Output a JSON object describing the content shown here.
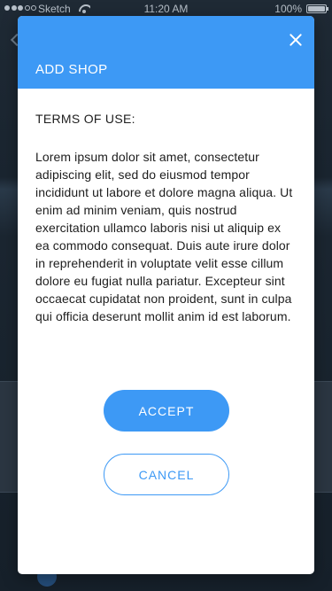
{
  "status_bar": {
    "carrier": "Sketch",
    "time": "11:20 AM",
    "battery": "100%",
    "battery_level": 1.0,
    "icons": [
      "signal-icon",
      "wifi-icon",
      "battery-icon"
    ]
  },
  "modal": {
    "title": "ADD SHOP",
    "close_icon": "close-icon",
    "terms_heading": "TERMS OF USE:",
    "terms_text": "Lorem ipsum dolor sit amet, consectetur adipiscing elit, sed do eiusmod tempor incididunt ut labore et dolore magna aliqua. Ut enim ad minim veniam, quis nostrud exercitation ullamco laboris nisi ut aliquip ex ea commodo consequat. Duis aute irure dolor in reprehenderit in voluptate velit esse cillum dolore eu fugiat nulla pariatur. Excepteur sint occaecat cupidatat non proident, sunt in culpa qui officia deserunt mollit anim id est laborum.",
    "accept_label": "ACCEPT",
    "cancel_label": "CANCEL"
  },
  "colors": {
    "accent": "#3d99f5",
    "header_text": "#ffffff",
    "body_text": "#1d1d1d",
    "backdrop": "#1c2630"
  }
}
